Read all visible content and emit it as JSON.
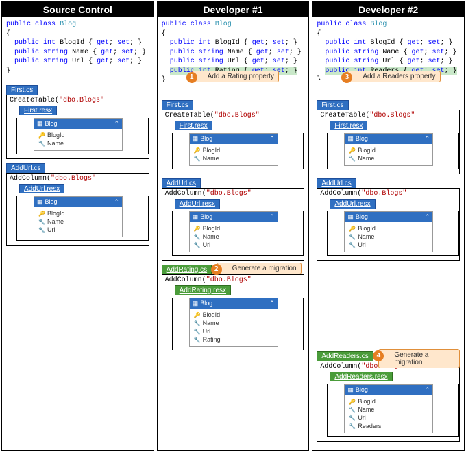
{
  "columns": [
    {
      "id": "source",
      "title": "Source Control"
    },
    {
      "id": "dev1",
      "title": "Developer #1"
    },
    {
      "id": "dev2",
      "title": "Developer #2"
    }
  ],
  "code": {
    "kw_public": "public",
    "kw_class": "class",
    "kw_int": "int",
    "kw_string": "string",
    "kw_get": "get",
    "kw_set": "set",
    "type_blog": "Blog",
    "prop_blogid": "BlogId",
    "prop_name": "Name",
    "prop_url": "Url",
    "prop_rating": "Rating",
    "prop_readers": "Readers",
    "brace_open": "{",
    "brace_close": "}",
    "semi": ";"
  },
  "callouts": {
    "c1": {
      "num": "1",
      "text": "Add a Rating property"
    },
    "c2": {
      "num": "2",
      "text": "Generate a migration"
    },
    "c3": {
      "num": "3",
      "text": "Add a Readers property"
    },
    "c4": {
      "num": "4",
      "text": "Generate a migration"
    }
  },
  "files": {
    "first_cs": "First.cs",
    "first_resx": "First.resx",
    "addurl_cs": "AddUrl.cs",
    "addurl_resx": "AddUrl.resx",
    "addrating_cs": "AddRating.cs",
    "addrating_resx": "AddRating.resx",
    "addreaders_cs": "AddReaders.cs",
    "addreaders_resx": "AddReaders.resx"
  },
  "snippets": {
    "createtable": "CreateTable(",
    "addcolumn": "AddColumn(",
    "dbo_blogs": "\"dbo.Blogs\"",
    "paren_close": ")"
  },
  "schema": {
    "title": "Blog",
    "blogid": "BlogId",
    "name": "Name",
    "url": "Url",
    "rating": "Rating",
    "readers": "Readers"
  }
}
